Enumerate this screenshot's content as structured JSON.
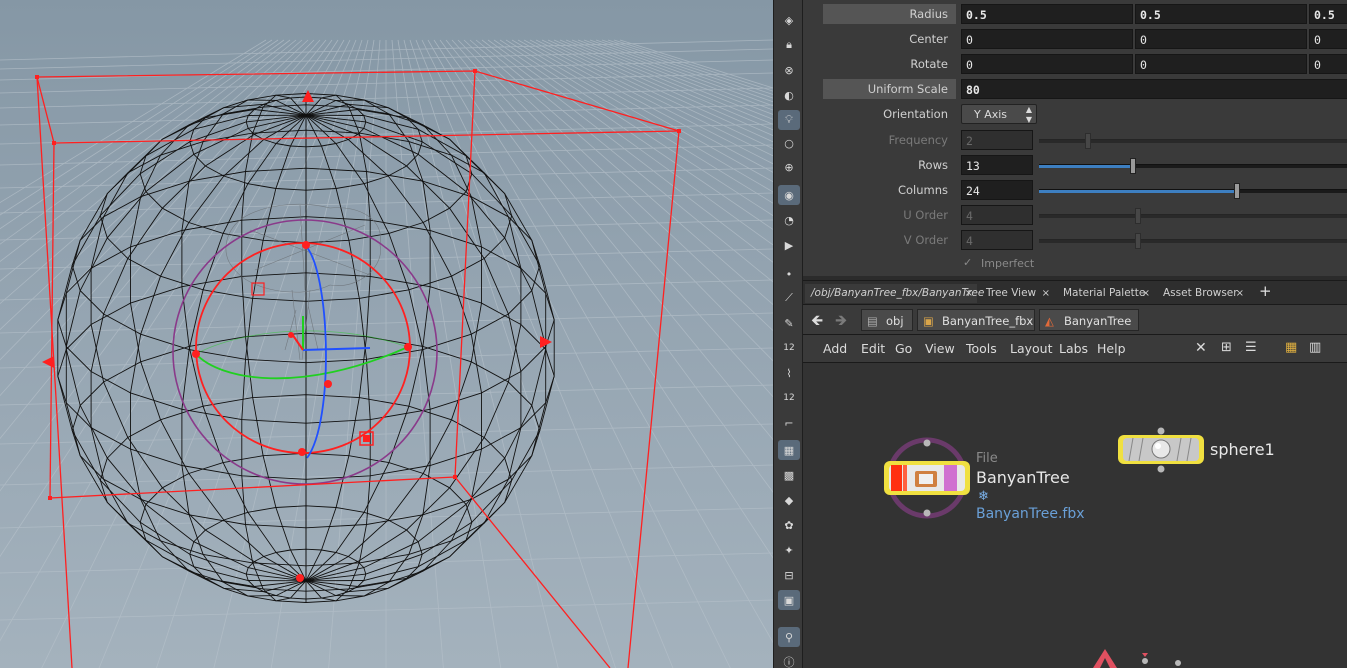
{
  "parameters": {
    "radius": {
      "label": "Radius",
      "values": [
        "0.5",
        "0.5",
        "0.5"
      ]
    },
    "center": {
      "label": "Center",
      "values": [
        "0",
        "0",
        "0"
      ]
    },
    "rotate": {
      "label": "Rotate",
      "values": [
        "0",
        "0",
        "0"
      ]
    },
    "uniform_scale": {
      "label": "Uniform Scale",
      "value": "80"
    },
    "orientation": {
      "label": "Orientation",
      "value": "Y Axis"
    },
    "frequency": {
      "label": "Frequency",
      "value": "2"
    },
    "rows": {
      "label": "Rows",
      "value": "13",
      "slider_fraction": 0.3
    },
    "columns": {
      "label": "Columns",
      "value": "24",
      "slider_fraction": 0.64
    },
    "u_order": {
      "label": "U Order",
      "value": "4"
    },
    "v_order": {
      "label": "V Order",
      "value": "4"
    },
    "imperfect": {
      "label": "Imperfect",
      "checked": true
    }
  },
  "tabs": [
    {
      "label": "/obj/BanyanTree_fbx/BanyanTree",
      "active": true
    },
    {
      "label": "Tree View",
      "active": false
    },
    {
      "label": "Material Palette",
      "active": false
    },
    {
      "label": "Asset Browser",
      "active": false
    }
  ],
  "tab_close": "×",
  "tab_add": "+",
  "path": [
    "obj",
    "BanyanTree_fbx",
    "BanyanTree"
  ],
  "menus": [
    "Add",
    "Edit",
    "Go",
    "View",
    "Tools",
    "Layout",
    "Labs",
    "Help"
  ],
  "nodes": {
    "file_node": {
      "type_label": "File",
      "name": "BanyanTree",
      "file": "BanyanTree.fbx",
      "flag_icon": "❄"
    },
    "sphere_node": {
      "name": "sphere1"
    }
  },
  "shelf_labels": {
    "twelve_a": "12",
    "twelve_b": "12"
  },
  "colors": {
    "handle_red": "#ff2020",
    "axis_green": "#20d020",
    "axis_blue": "#2050ff",
    "ring_purple": "#8a3a8a",
    "slider_blue": "#3d7fc1",
    "node_yellow": "#f0e040"
  }
}
